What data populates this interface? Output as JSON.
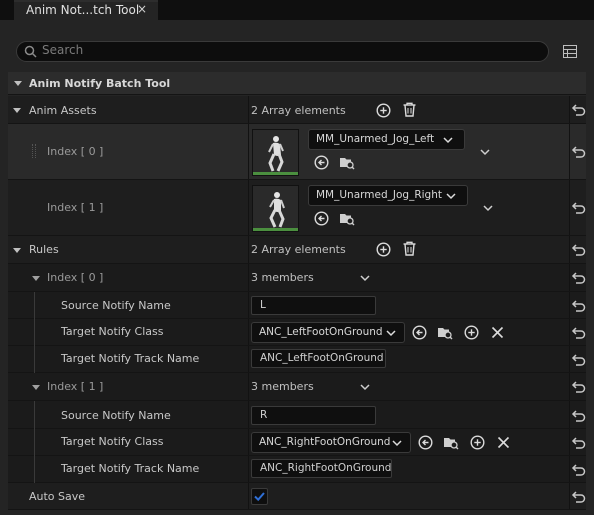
{
  "tab": {
    "title": "Anim Not...tch Tool",
    "close_glyph": "×"
  },
  "search": {
    "placeholder": "Search"
  },
  "category": {
    "title": "Anim Notify Batch Tool"
  },
  "anim_assets": {
    "label": "Anim Assets",
    "count_text": "2 Array elements",
    "items": [
      {
        "index_label": "Index [ 0 ]",
        "asset_name": "MM_Unarmed_Jog_Left"
      },
      {
        "index_label": "Index [ 1 ]",
        "asset_name": "MM_Unarmed_Jog_Right"
      }
    ]
  },
  "rules": {
    "label": "Rules",
    "count_text": "2 Array elements",
    "items": [
      {
        "index_label": "Index [ 0 ]",
        "members_text": "3 members",
        "source_label": "Source Notify Name",
        "source_value": "L",
        "class_label": "Target Notify Class",
        "class_value": "ANC_LeftFootOnGround",
        "track_label": "Target Notify Track Name",
        "track_value": "ANC_LeftFootOnGround"
      },
      {
        "index_label": "Index [ 1 ]",
        "members_text": "3 members",
        "source_label": "Source Notify Name",
        "source_value": "R",
        "class_label": "Target Notify Class",
        "class_value": "ANC_RightFootOnGround",
        "track_label": "Target Notify Track Name",
        "track_value": "ANC_RightFootOnGround"
      }
    ]
  },
  "auto_save": {
    "label": "Auto Save",
    "checked": true
  },
  "colors": {
    "accent": "#2f6fd6",
    "thumb_bar": "#4b8f3f",
    "panel": "#242424"
  },
  "icons": [
    "search-icon",
    "settings-grid-icon",
    "add-icon",
    "trash-icon",
    "reset-arrow-icon",
    "use-selected-icon",
    "browse-icon",
    "clear-icon",
    "chevron-down-icon",
    "checkmark-icon"
  ]
}
